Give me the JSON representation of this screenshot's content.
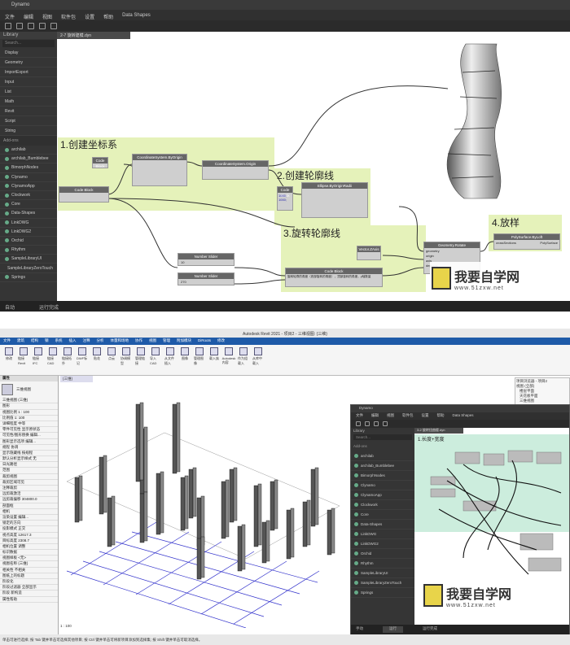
{
  "top": {
    "title": "Dynamo",
    "menu": [
      "文件",
      "编辑",
      "视图",
      "软件包",
      "设置",
      "帮助",
      "Data Shapes"
    ],
    "tab": "2-7 旋转建模.dyn",
    "library_header": "Library",
    "search_placeholder": "Search...",
    "library_items": [
      "Display",
      "Geometry",
      "ImportExport",
      "Input",
      "List",
      "Math",
      "Revit",
      "Script",
      "String"
    ],
    "addon_label": "Add-ons",
    "addon_items": [
      "archilab",
      "archilab_Bumblebee",
      "BimorphNodes",
      "Clynamo",
      "ClynamoApp",
      "Clockwork",
      "Core",
      "Data-Shapes",
      "LinkDWG",
      "LinkDWG2",
      "Orchid",
      "Rhythm",
      "SampleLibraryUI",
      "SampleLibraryZeroTouch",
      "Springs"
    ],
    "groups": [
      "1.创建坐标系",
      "2.创建轮廓线",
      "3.旋转轮廓线",
      "4.放样"
    ],
    "nodes": {
      "code_block": "Code Block",
      "cs_byorigin": "CoordinateSystem.ByOrigin",
      "cs_origin": "CoordinateSystem.Origin",
      "ellipse": "Ellipse.ByOriginRadii",
      "vector": "Vector.ZAxis",
      "geometry_rotate": "Geometry.Rotate",
      "polysurface": "PolySurface.ByLoft",
      "number_slider": "Number Slider",
      "slider1": "10",
      "slider2": "270",
      "code_text": "旋转轮廓的角度（底部旋转的角度），顶部旋转的角度，y轴数量",
      "ellipse_vals": "1000; 1000;",
      "ports_geom": "geometry",
      "ports_origin": "origin",
      "ports_axis": "axis",
      "ports_degrees": "degrees",
      "cross_sections": "crossSections",
      "poly_out": "PolySurface"
    },
    "status": [
      "自动",
      "运行完成"
    ]
  },
  "watermark": {
    "brand": "我要自学网",
    "url": "www.51zxw.net"
  },
  "bottom": {
    "title": "Autodesk Revit 2021 - 项目2 - 三维视图: {三维}",
    "menu": [
      "文件",
      "建筑",
      "结构",
      "钢",
      "系统",
      "插入",
      "注释",
      "分析",
      "体量和场地",
      "协作",
      "视图",
      "管理",
      "附加模块",
      "DiRoots",
      "修改"
    ],
    "ribbon_buttons": [
      "修改",
      "链接Revit",
      "链接IFC",
      "链接CAD",
      "链接拓扑",
      "DWF标记",
      "贴花",
      "点云",
      "协调模型",
      "管理链接",
      "导入CAD",
      "从文件插入",
      "图像",
      "管理图像",
      "载入族",
      "Autodesk内容",
      "作为组载入",
      "从库中载入"
    ],
    "props_title": "属性",
    "props_type": "三维视图",
    "props_rows": [
      "三维视图 (三维)",
      "图形",
      "视图比例  1 : 100",
      "比例值 1:  100",
      "详细程度  中等",
      "零件可见性  显示原状态",
      "可见性/图形替换  编辑...",
      "图形显示选项  编辑...",
      "规程  协调",
      "显示隐藏线  按规程",
      "默认分析显示样式  无",
      "日光路径",
      "范围",
      "裁剪视图",
      "裁剪区域可见",
      "注释裁剪",
      "远剪裁激活",
      "远剪裁偏移  304800.0",
      "剖面框",
      "相机",
      "渲染设置  编辑...",
      "锁定的方向",
      "投影模式  正交",
      "视点高度  12617.3",
      "目标高度  2308.7",
      "相机位置  调整",
      "标识数据",
      "视图样板  <无>",
      "视图名称  {三维}",
      "相关性  不相关",
      "图纸上的标题",
      "阶段化",
      "阶段过滤器  全部显示",
      "阶段  新构造"
    ],
    "props_help": "属性帮助",
    "view_tab": "{三维}",
    "browser_title": "项目浏览器 - 项目2",
    "browser_items": [
      "视图 (全部)",
      "楼层平面",
      "天花板平面",
      "三维视图"
    ],
    "status": "单击可进行选择; 按 Tab 键并单击可选择其他项目; 按 Ctrl 键并单击可将新项目添加到选择集; 按 Shift 键并单击可取消选择。",
    "scale": "1 : 100",
    "small_dynamo": {
      "title": "Dynamo",
      "menu": [
        "文件",
        "编辑",
        "视图",
        "软件包",
        "设置",
        "帮助",
        "Data Shapes"
      ],
      "tab": "3-2 旋转扭曲楼.dyn",
      "library_header": "Library",
      "search_placeholder": "Search...",
      "addon_label": "Add-ons",
      "items": [
        "archilab",
        "archilab_Bumblebee",
        "BimorphNodes",
        "Clynamo",
        "ClynamoApp",
        "Clockwork",
        "Core",
        "Data-Shapes",
        "LinkDWG",
        "LinkDWG2",
        "Orchid",
        "Rhythm",
        "SampleLibraryUI",
        "SampleLibraryZeroTouch",
        "Springs"
      ],
      "group": "1.长度+宽度",
      "status": [
        "手动",
        "运行",
        "运行完成"
      ]
    }
  }
}
